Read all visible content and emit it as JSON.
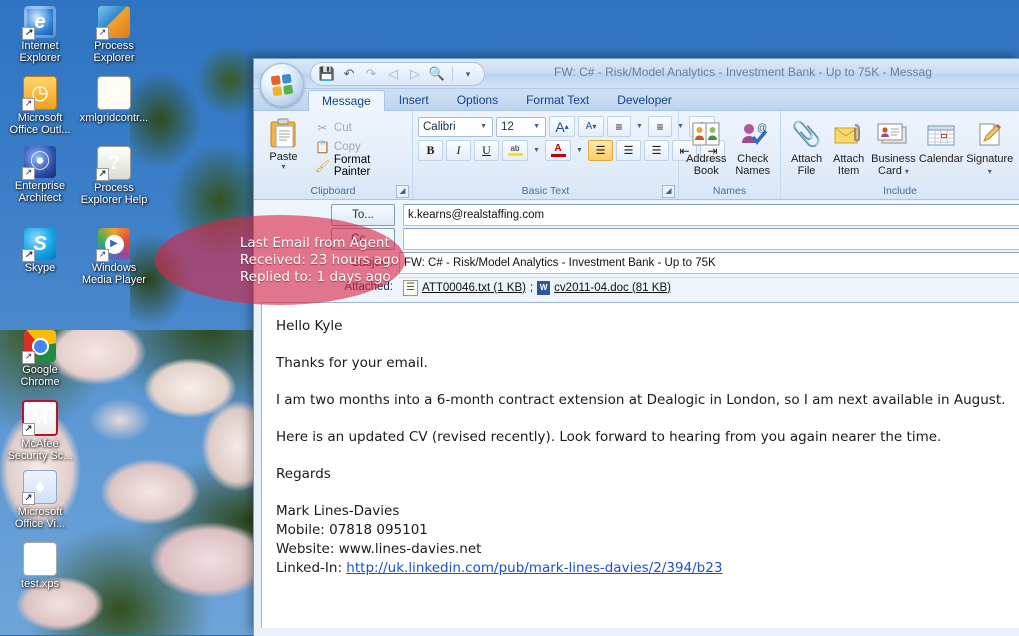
{
  "desktop": {
    "icons": [
      {
        "label": "Internet Explorer",
        "icon": "internet-explorer-icon",
        "shortcut": true
      },
      {
        "label": "Process Explorer",
        "icon": "process-explorer-icon",
        "shortcut": true
      },
      {
        "label": "Microsoft Office Outl...",
        "icon": "microsoft-outlook-icon",
        "shortcut": true
      },
      {
        "label": "xmlgridcontr...",
        "icon": "xml-document-icon",
        "shortcut": false
      },
      {
        "label": "Enterprise Architect",
        "icon": "enterprise-architect-icon",
        "shortcut": true
      },
      {
        "label": "Process Explorer Help",
        "icon": "help-document-icon",
        "shortcut": true
      },
      {
        "label": "Skype",
        "icon": "skype-icon",
        "shortcut": true
      },
      {
        "label": "Windows Media Player",
        "icon": "windows-media-player-icon",
        "shortcut": true
      },
      {
        "label": "Google Chrome",
        "icon": "google-chrome-icon",
        "shortcut": true
      },
      {
        "label": "McAfee Security Sc...",
        "icon": "mcafee-icon",
        "shortcut": true
      },
      {
        "label": "Microsoft Office Vi...",
        "icon": "microsoft-visio-icon",
        "shortcut": true
      },
      {
        "label": "test.xps",
        "icon": "xps-document-icon",
        "shortcut": false
      }
    ]
  },
  "window": {
    "title": "FW: C# - Risk/Model Analytics - Investment Bank - Up to 75K - Messag",
    "office_button": "office-orb",
    "quick_access": [
      {
        "name": "save-button",
        "glyph": "💾"
      },
      {
        "name": "undo-button",
        "glyph": "↶"
      },
      {
        "name": "redo-button",
        "glyph": "↷"
      },
      {
        "name": "previous-item-button",
        "glyph": "◂"
      },
      {
        "name": "next-item-button",
        "glyph": "▸"
      },
      {
        "name": "print-preview-button",
        "glyph": "🔍"
      },
      {
        "name": "customize-qat-button",
        "glyph": "▾"
      }
    ]
  },
  "tabs": [
    {
      "label": "Message",
      "active": true
    },
    {
      "label": "Insert",
      "active": false
    },
    {
      "label": "Options",
      "active": false
    },
    {
      "label": "Format Text",
      "active": false
    },
    {
      "label": "Developer",
      "active": false
    }
  ],
  "ribbon": {
    "clipboard": {
      "group_label": "Clipboard",
      "paste": "Paste",
      "cut": "Cut",
      "copy": "Copy",
      "format_painter": "Format Painter"
    },
    "basic_text": {
      "group_label": "Basic Text",
      "font_name": "Calibri",
      "font_size": "12",
      "grow_font": "A",
      "shrink_font": "A",
      "bold": "B",
      "italic": "I",
      "underline": "U",
      "highlight": "ab",
      "font_color": "A",
      "bullets": "≡",
      "numbering": "≡",
      "clear_formatting": "A",
      "align_left": "☰",
      "align_center": "☰",
      "align_right": "☰",
      "decrease_indent": "⇤",
      "increase_indent": "⇥"
    },
    "names": {
      "group_label": "Names",
      "address_book": "Address Book",
      "check_names": "Check Names"
    },
    "include": {
      "group_label": "Include",
      "attach_file": "Attach File",
      "attach_item": "Attach Item",
      "business_card": "Business Card",
      "calendar": "Calendar",
      "signature": "Signature"
    }
  },
  "message": {
    "to_button": "To...",
    "cc_button": "Cc...",
    "subject_label": "Subject:",
    "attached_label": "Attached:",
    "to_value": "k.kearns@realstaffing.com",
    "cc_value": "",
    "subject_value": "FW: C# - Risk/Model Analytics - Investment Bank - Up to 75K",
    "attachments": [
      {
        "name": "ATT00046.txt (1 KB)",
        "type": "txt"
      },
      {
        "name": "cv2011-04.doc (81 KB)",
        "type": "doc"
      }
    ],
    "attachment_separator": ";",
    "body": {
      "greeting": "Hello Kyle",
      "p1": "Thanks for your email.",
      "p2": "I am two months into a 6-month contract extension at Dealogic in London, so I am next available in August.",
      "p3": "Here is an updated CV (revised recently). Look forward to hearing from you again nearer the time.",
      "closing": "Regards",
      "sig_name": "Mark Lines-Davies",
      "sig_mobile": "Mobile: 07818 095101",
      "sig_website": "Website: www.lines-davies.net",
      "sig_linkedin_label": "Linked-In: ",
      "sig_linkedin_url": "http://uk.linkedin.com/pub/mark-lines-davies/2/394/b23"
    }
  },
  "annotation": {
    "line1": "Last Email from Agent",
    "line2": "Received:  23 hours ago",
    "line3": "Replied to:  1 days ago",
    "color": "#d62646"
  }
}
